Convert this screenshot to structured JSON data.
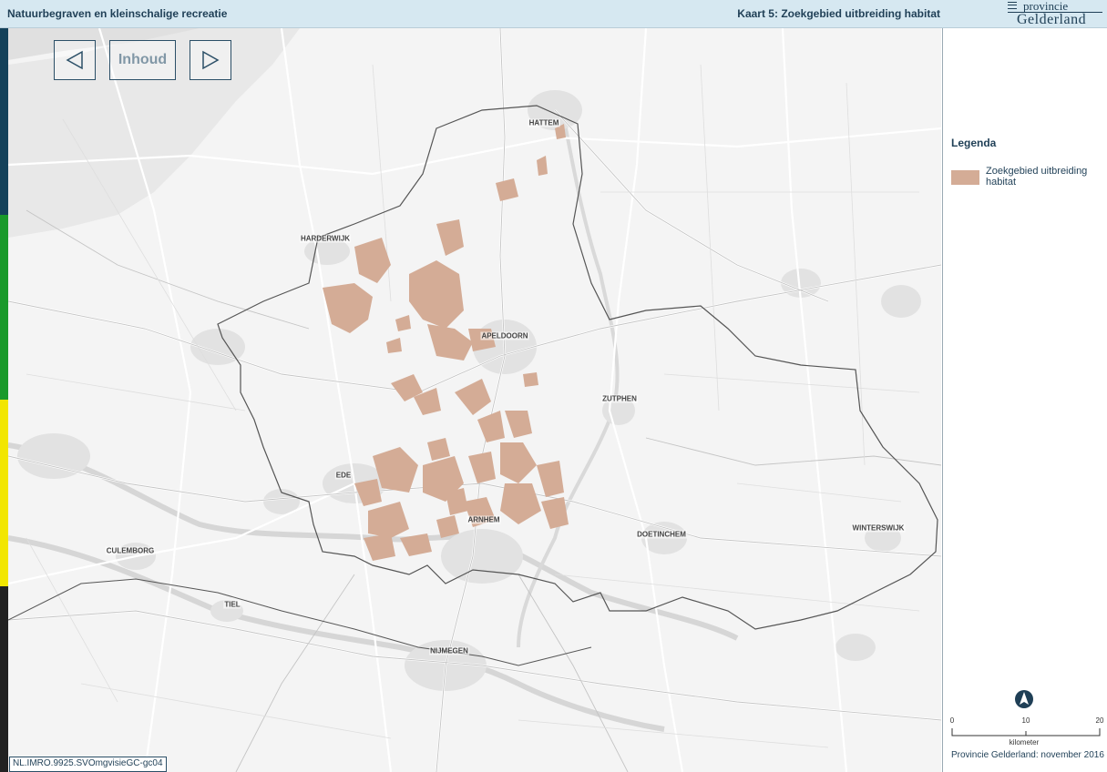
{
  "header": {
    "document_title": "Natuurbegraven en kleinschalige recreatie",
    "map_title": "Kaart 5: Zoekgebied uitbreiding habitat",
    "logo_line1": "provincie",
    "logo_line2": "Gelderland"
  },
  "nav": {
    "contents_label": "Inhoud",
    "prev_icon": "triangle-left-icon",
    "next_icon": "triangle-right-icon"
  },
  "map": {
    "plan_code": "NL.IMRO.9925.SVOmgvisieGC-gc04",
    "cities": [
      "HATTEM",
      "HARDERWIJK",
      "APELDOORN",
      "ZUTPHEN",
      "EDE",
      "ARNHEM",
      "DOETINCHEM",
      "WINTERSWIJK",
      "CULEMBORG",
      "TIEL",
      "NIJMEGEN"
    ],
    "colors": {
      "background": "#f4f4f4",
      "water": "#d9d9d9",
      "urban": "#e2e2e2",
      "roads": "#ffffff",
      "boundary": "#555555",
      "habitat": "#d4ac96"
    }
  },
  "legend": {
    "title": "Legenda",
    "items": [
      {
        "label": "Zoekgebied uitbreiding habitat",
        "color": "#d4ac96"
      }
    ]
  },
  "scale": {
    "ticks": [
      "0",
      "10",
      "20"
    ],
    "unit": "kilometer"
  },
  "credit": "Provincie Gelderland: november 2016",
  "side_strip_colors": [
    "#14415a",
    "#1a9a2b",
    "#f2e600",
    "#222222"
  ]
}
